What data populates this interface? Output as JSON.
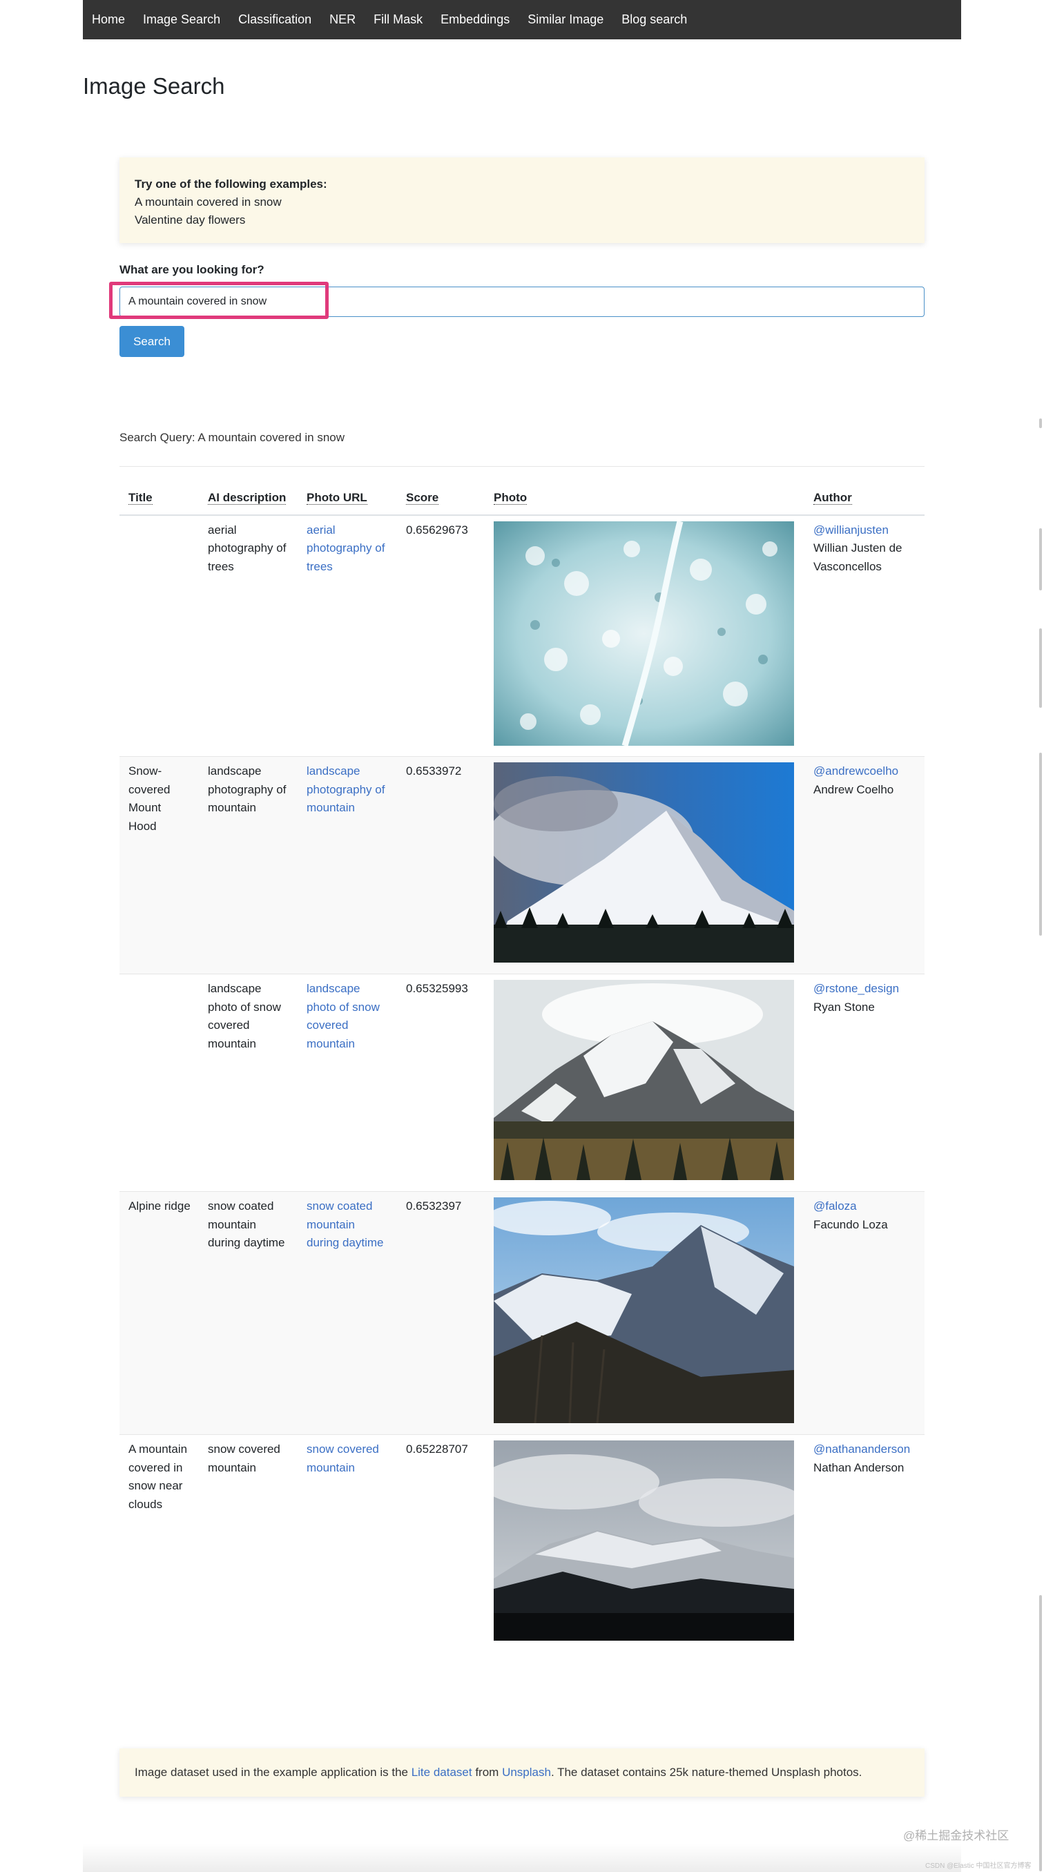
{
  "nav": {
    "items": [
      "Home",
      "Image Search",
      "Classification",
      "NER",
      "Fill Mask",
      "Embeddings",
      "Similar Image",
      "Blog search"
    ]
  },
  "page_title": "Image Search",
  "examples": {
    "heading": "Try one of the following examples:",
    "items": [
      "A mountain covered in snow",
      "Valentine day flowers"
    ]
  },
  "search": {
    "label": "What are you looking for?",
    "value": "A mountain covered in snow",
    "button": "Search"
  },
  "query_line": "Search Query: A mountain covered in snow",
  "table": {
    "headers": [
      "Title",
      "AI description",
      "Photo URL",
      "Score",
      "Photo",
      "Author"
    ],
    "rows": [
      {
        "title": "",
        "ai_description": "aerial photography of trees",
        "photo_url_text": "aerial photography of trees",
        "score": "0.65629673",
        "photo_theme": "snowy-forest-aerial",
        "author_handle": "@willianjusten",
        "author_name": "Willian Justen de Vasconcellos"
      },
      {
        "title": "Snow-covered Mount Hood",
        "ai_description": "landscape photography of mountain",
        "photo_url_text": "landscape photography of mountain",
        "score": "0.6533972",
        "photo_theme": "mount-hood-blue-sky",
        "author_handle": "@andrewcoelho",
        "author_name": "Andrew Coelho"
      },
      {
        "title": "",
        "ai_description": "landscape photo of snow covered mountain",
        "photo_url_text": "landscape photo of snow covered mountain",
        "score": "0.65325993",
        "photo_theme": "misty-snow-peak",
        "author_handle": "@rstone_design",
        "author_name": "Ryan Stone"
      },
      {
        "title": "Alpine ridge",
        "ai_description": "snow coated mountain during daytime",
        "photo_url_text": "snow coated mountain during daytime",
        "score": "0.6532397",
        "photo_theme": "alpine-ridge",
        "author_handle": "@faloza",
        "author_name": "Facundo Loza"
      },
      {
        "title": "A mountain covered in snow near clouds",
        "ai_description": "snow covered mountain",
        "photo_url_text": "snow covered mountain",
        "score": "0.65228707",
        "photo_theme": "cloudy-snow-hills",
        "author_handle": "@nathananderson",
        "author_name": "Nathan Anderson"
      }
    ]
  },
  "footer": {
    "prefix": "Image dataset used in the example application is the ",
    "lite_link": "Lite dataset",
    "middle": " from ",
    "unsplash_link": "Unsplash",
    "suffix": ". The dataset contains 25k nature-themed Unsplash photos."
  },
  "watermark": "@稀土掘金技术社区",
  "watermark_small": "CSDN @Elastic 中国社区官方博客",
  "colors": {
    "navbar": "#343434",
    "accent_button": "#3b8ed4",
    "link": "#3b6fc4",
    "highlight": "#e03a7b",
    "note_background": "#fcf8e8"
  }
}
